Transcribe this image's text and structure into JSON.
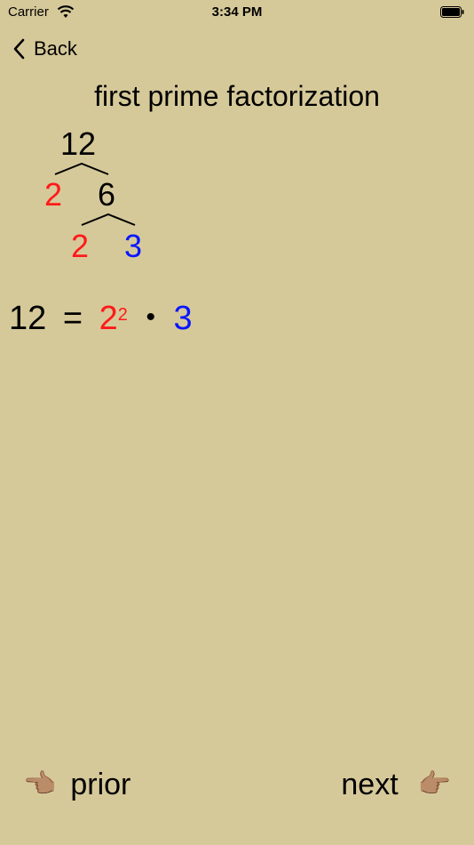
{
  "status": {
    "carrier": "Carrier",
    "time": "3:34 PM"
  },
  "nav": {
    "back_label": "Back"
  },
  "title": "first prime factorization",
  "tree": {
    "root": "12",
    "level1": {
      "left": "2",
      "right": "6"
    },
    "level2": {
      "left": "2",
      "right": "3"
    }
  },
  "equation": {
    "lhs": "12",
    "equals": "=",
    "base": "2",
    "exponent": "2",
    "dot": "•",
    "factor": "3"
  },
  "footer": {
    "prior_label": "prior",
    "next_label": "next",
    "prior_icon": "👈🏽",
    "next_icon": "👉🏽"
  },
  "colors": {
    "background": "#d6c999",
    "prime_red": "#ff1a1a",
    "prime_blue": "#0a16ff"
  }
}
